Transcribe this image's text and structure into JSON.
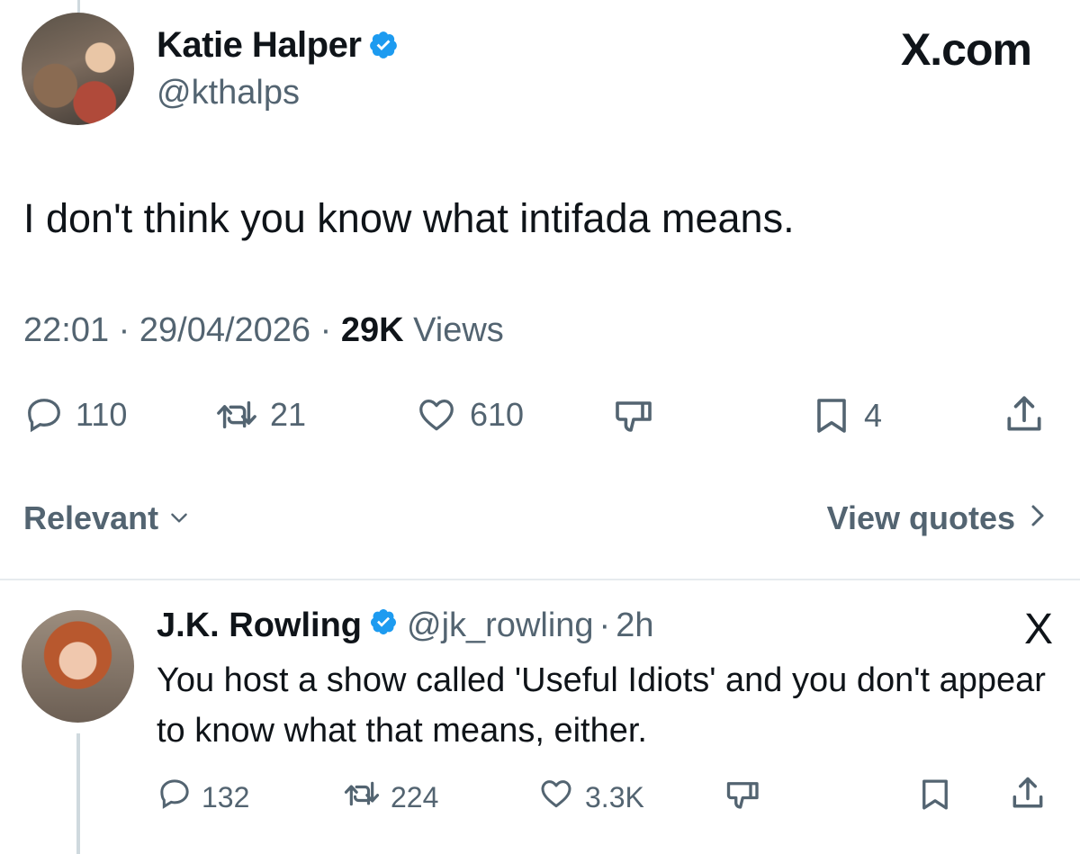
{
  "main_tweet": {
    "author_name": "Katie Halper",
    "handle": "@kthalps",
    "site_badge": "X.com",
    "text": "I don't think you know what intifada means.",
    "time": "22:01",
    "date": "29/04/2026",
    "views_count": "29K",
    "views_label": "Views",
    "replies": "110",
    "reposts": "21",
    "likes": "610",
    "bookmarks": "4"
  },
  "sort": {
    "label": "Relevant",
    "view_quotes": "View quotes"
  },
  "reply_tweet": {
    "author_name": "J.K. Rowling",
    "handle": "@jk_rowling",
    "age": "2h",
    "site_badge": "X",
    "text": "You host a show called 'Useful Idiots' and you don't appear to know what that means, either.",
    "replies": "132",
    "reposts": "224",
    "likes": "3.3K"
  },
  "icons": {
    "reply": "reply-icon",
    "repost": "repost-icon",
    "like": "heart-icon",
    "dislike": "thumbs-down-icon",
    "bookmark": "bookmark-icon",
    "share": "share-icon",
    "verified": "verified-badge-icon"
  },
  "colors": {
    "verified": "#1d9bf0",
    "secondary_text": "#536471",
    "primary_text": "#0f1419"
  }
}
